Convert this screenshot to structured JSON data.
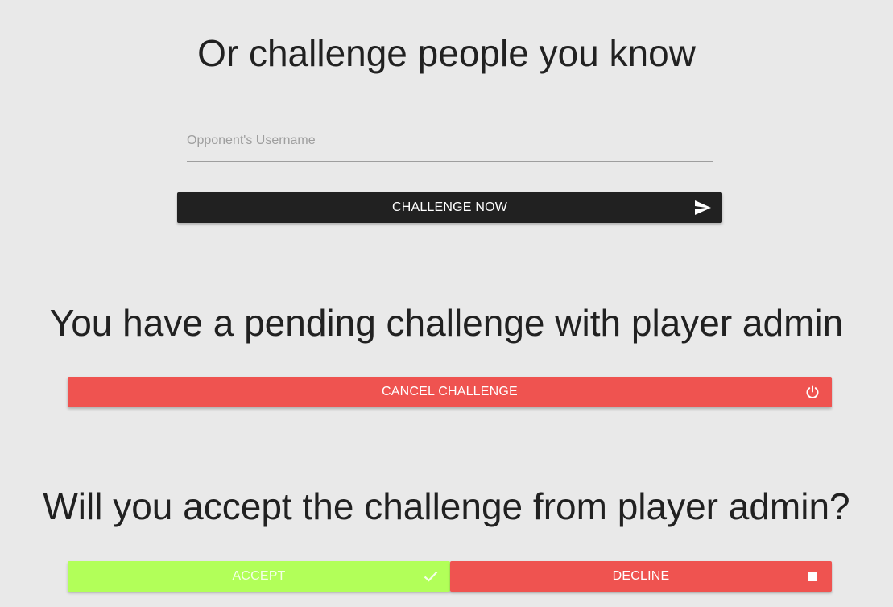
{
  "challenge_section": {
    "title": "Or challenge people you know",
    "username_placeholder": "Opponent's Username",
    "username_value": "",
    "challenge_button_label": "CHALLENGE NOW",
    "challenge_button_icon": "send-icon"
  },
  "pending_section": {
    "title": "You have a pending challenge with player admin",
    "cancel_button_label": "CANCEL CHALLENGE",
    "cancel_button_icon": "power-icon"
  },
  "incoming_section": {
    "title": "Will you accept the challenge from player admin?",
    "accept_button_label": "ACCEPT",
    "accept_button_icon": "check-icon",
    "decline_button_label": "DECLINE",
    "decline_button_icon": "stop-icon"
  },
  "colors": {
    "background": "#e9e9e9",
    "dark_button": "#212121",
    "danger_button": "#ef5350",
    "accept_button": "#b2ff59"
  }
}
